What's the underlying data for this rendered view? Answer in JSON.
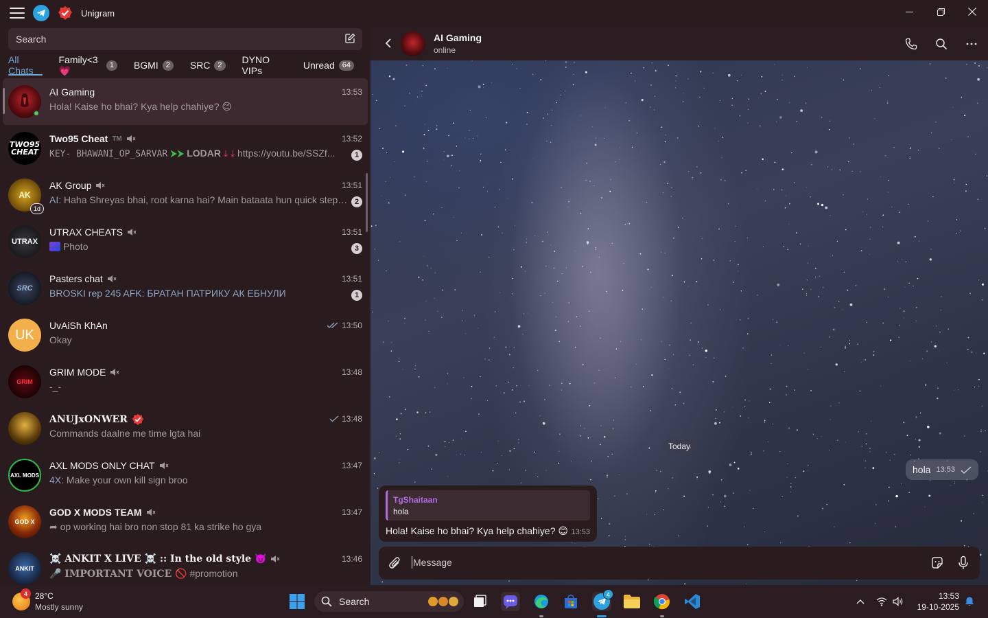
{
  "window": {
    "app_title": "Unigram",
    "minimize_icon": "minimize-icon",
    "maximize_icon": "restore-icon",
    "close_icon": "close-icon"
  },
  "search": {
    "placeholder": "Search"
  },
  "folders": [
    {
      "label": "All Chats",
      "count": null,
      "active": true
    },
    {
      "label": "Family<3💗",
      "count": "1"
    },
    {
      "label": "BGMI",
      "count": "2"
    },
    {
      "label": "SRC",
      "count": "2"
    },
    {
      "label": "DYNO VIPs",
      "count": null
    },
    {
      "label": "Unread",
      "count": "64"
    }
  ],
  "chats": [
    {
      "name": "AI Gaming",
      "time": "13:53",
      "preview": "Hola! Kaise ho bhai? Kya help chahiye? 😊",
      "selected": true,
      "online": true
    },
    {
      "name": "Two95 Cheat",
      "tm": "TM",
      "time": "13:52",
      "preview_a": "KEY- BHAWANI_OP_SARVAR",
      "preview_b": "LODAR",
      "preview_c": "https://youtu.be/SSZf...",
      "unread": "1",
      "muted": true
    },
    {
      "name": "AK Group",
      "time": "13:51",
      "sender": "AI:",
      "preview": "Haha Shreyas bhai, root karna hai? Main bataata hun quick steps:...",
      "unread": "2",
      "muted": true,
      "story_badge": "1d"
    },
    {
      "name": "UTRAX CHEATS",
      "time": "13:51",
      "preview": "Photo",
      "unread": "3",
      "muted": true
    },
    {
      "name": "Pasters chat",
      "time": "13:51",
      "sender": "BROSKI rep 245 AFK:",
      "preview": "БРАТАН ПАТРИКУ АК ЕБНУЛИ",
      "unread": "1",
      "muted": true
    },
    {
      "name": "UvAiSh KhAn",
      "time": "13:50",
      "preview": "Okay",
      "read_ticks": "double",
      "avatar_initials": "UK"
    },
    {
      "name": "GRIM MODE",
      "time": "13:48",
      "preview": "-_-",
      "muted": true
    },
    {
      "name": "ANUJxONWER",
      "time": "13:48",
      "preview": "Commands daalne me time lgta hai",
      "verified": true,
      "read_ticks": "single"
    },
    {
      "name": "AXL MODS ONLY CHAT",
      "time": "13:47",
      "sender": "4X:",
      "preview": "Make your own kill sign broo",
      "muted": true
    },
    {
      "name": "GOD X MODS TEAM",
      "time": "13:47",
      "preview": "op working hai bro non stop 81 ka strike ho gya",
      "muted": true
    },
    {
      "name": "☠️ ANKIT X LIVE ☠️ :: In the old style 😈",
      "time": "13:46",
      "preview_a": "🎤 IMPORTANT VOICE 🚫",
      "preview_b": "#promotion",
      "muted": true
    }
  ],
  "conversation": {
    "name": "AI Gaming",
    "status": "online",
    "date_separator": "Today",
    "outgoing": {
      "text": "hola",
      "time": "13:53"
    },
    "incoming": {
      "reply_name": "TgShaitaan",
      "reply_text": "hola",
      "text": "Hola! Kaise ho bhai? Kya help chahiye? 😊",
      "time": "13:53"
    },
    "composer_placeholder": "Message"
  },
  "taskbar": {
    "weather_temp": "28°C",
    "weather_condition": "Mostly sunny",
    "weather_badge": "4",
    "search_label": "Search",
    "telegram_badge": "4",
    "clock_time": "13:53",
    "clock_date": "19-10-2025"
  },
  "colors": {
    "background": "#2a1b1f",
    "selected_row": "#3c2a30",
    "accent_blue": "#6fa8d6",
    "reply_purple": "#b36ee6",
    "online_green": "#4fcd5a"
  }
}
